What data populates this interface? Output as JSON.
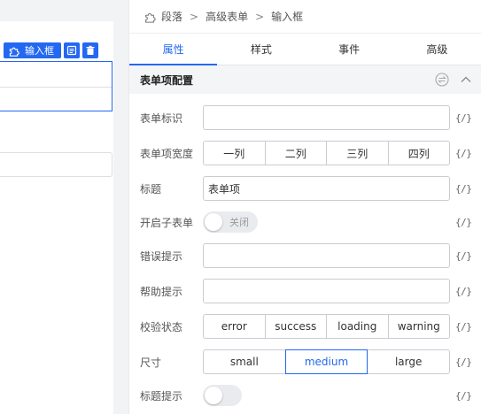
{
  "canvas": {
    "toolbar_label": "输入框"
  },
  "breadcrumb": {
    "items": [
      "段落",
      "高级表单",
      "输入框"
    ]
  },
  "tabs": [
    "属性",
    "样式",
    "事件",
    "高级"
  ],
  "section": {
    "title": "表单项配置"
  },
  "fx_label": "{/}",
  "fields": {
    "form_id": {
      "label": "表单标识",
      "value": ""
    },
    "item_width": {
      "label": "表单项宽度",
      "options": [
        "一列",
        "二列",
        "三列",
        "四列"
      ]
    },
    "title": {
      "label": "标题",
      "value": "表单项"
    },
    "sub_form": {
      "label": "开启子表单",
      "state_text": "关闭"
    },
    "error_tip": {
      "label": "错误提示",
      "value": ""
    },
    "help_tip": {
      "label": "帮助提示",
      "value": ""
    },
    "validate_status": {
      "label": "校验状态",
      "options": [
        "error",
        "success",
        "loading",
        "warning"
      ]
    },
    "size": {
      "label": "尺寸",
      "options": [
        "small",
        "medium",
        "large"
      ],
      "selected": "medium"
    },
    "title_tip": {
      "label": "标题提示"
    }
  },
  "colors": {
    "accent": "#2468f2",
    "section_bg": "#f4f5f6"
  }
}
